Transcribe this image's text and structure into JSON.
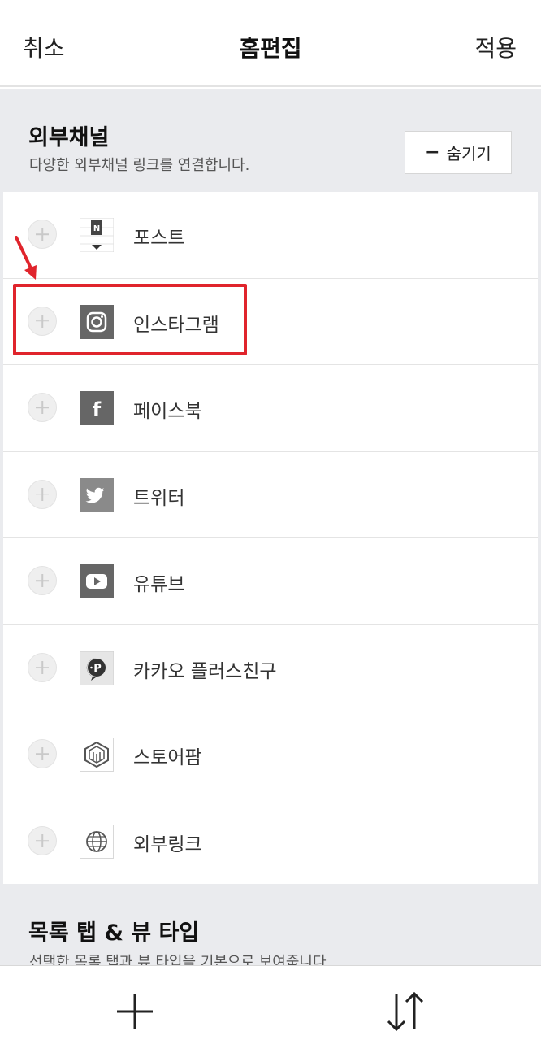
{
  "header": {
    "cancel": "취소",
    "title": "홈편집",
    "apply": "적용"
  },
  "external": {
    "title": "외부채널",
    "desc": "다양한 외부채널 링크를 연결합니다.",
    "hide_label": "숨기기",
    "items": [
      {
        "label": "포스트",
        "icon": "naver-post-icon"
      },
      {
        "label": "인스타그램",
        "icon": "instagram-icon"
      },
      {
        "label": "페이스북",
        "icon": "facebook-icon"
      },
      {
        "label": "트위터",
        "icon": "twitter-icon"
      },
      {
        "label": "유튜브",
        "icon": "youtube-icon"
      },
      {
        "label": "카카오 플러스친구",
        "icon": "kakao-plus-icon"
      },
      {
        "label": "스토어팜",
        "icon": "storefarm-icon"
      },
      {
        "label": "외부링크",
        "icon": "globe-icon"
      }
    ]
  },
  "list_section": {
    "title": "목록 탭 & 뷰 타입",
    "desc": "선택한 목록 탭과 뷰 타입을 기본으로 보여줍니다"
  },
  "colors": {
    "highlight": "#e0242c",
    "icon_gray": "#6b6b6b",
    "background": "#eaebee"
  }
}
